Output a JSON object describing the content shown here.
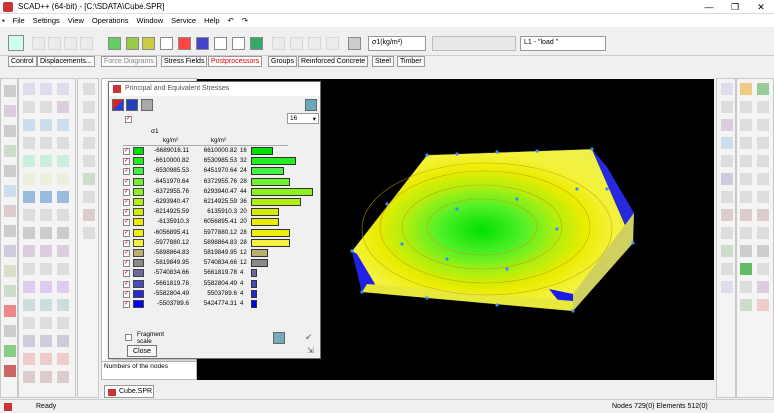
{
  "window": {
    "title": "SCAD++ (64-bit) - [C:\\SDATA\\Cube.SPR]",
    "controls": [
      "—",
      "❐",
      "✕"
    ]
  },
  "menu": [
    "File",
    "Settings",
    "View",
    "Operations",
    "Window",
    "Service",
    "Help"
  ],
  "toolbar": {
    "units_combo": "σ1(kg/m²)",
    "empty_combo": "",
    "load_combo": "L1 - \"load \""
  },
  "tabs": [
    "Control",
    "Displacements...",
    "Force Diagrams",
    "Stress Fields",
    "Postprocessors",
    "Groups",
    "Reinforced Concrete",
    "Steel",
    "Timber"
  ],
  "active_tab": "Postprocessors",
  "dialog": {
    "title": "Principal and Equivalent Stresses",
    "header_symbol": "σ1",
    "col1": "kg/m²",
    "col2": "kg/m²",
    "spin": "16",
    "fragment_label": "Fragment scale",
    "close": "Close",
    "rows": [
      {
        "from": "-6689016.11",
        "to": "6610000.82",
        "pct": "16",
        "color": "#00e000",
        "bar": 0.36
      },
      {
        "from": "-6610000.82",
        "to": "6530985.53",
        "pct": "32",
        "color": "#22ee22",
        "bar": 0.72
      },
      {
        "from": "-6530985.53",
        "to": "6451970.64",
        "pct": "24",
        "color": "#44f044",
        "bar": 0.54
      },
      {
        "from": "-6451970.64",
        "to": "6372955.76",
        "pct": "28",
        "color": "#6ff030",
        "bar": 0.63
      },
      {
        "from": "-6372955.76",
        "to": "6293940.47",
        "pct": "44",
        "color": "#8ef020",
        "bar": 1.0
      },
      {
        "from": "-6293940.47",
        "to": "6214925.59",
        "pct": "36",
        "color": "#b2ee10",
        "bar": 0.81
      },
      {
        "from": "-6214925.59",
        "to": "6135910.3",
        "pct": "20",
        "color": "#d2ec08",
        "bar": 0.45
      },
      {
        "from": "-6135910.3",
        "to": "6056895.41",
        "pct": "20",
        "color": "#eaec00",
        "bar": 0.45
      },
      {
        "from": "-6056895.41",
        "to": "5977880.12",
        "pct": "28",
        "color": "#f0ee10",
        "bar": 0.63
      },
      {
        "from": "-5977880.12",
        "to": "5898864.83",
        "pct": "28",
        "color": "#f6f040",
        "bar": 0.63
      },
      {
        "from": "-5898864.83",
        "to": "5819849.95",
        "pct": "12",
        "color": "#b8b070",
        "bar": 0.27
      },
      {
        "from": "-5819849.95",
        "to": "5740834.66",
        "pct": "12",
        "color": "#8a8a88",
        "bar": 0.27
      },
      {
        "from": "-5740834.66",
        "to": "5661819.78",
        "pct": "4",
        "color": "#6a6aa0",
        "bar": 0.09
      },
      {
        "from": "-5661819.78",
        "to": "5582804.49",
        "pct": "4",
        "color": "#4a4ac0",
        "bar": 0.09
      },
      {
        "from": "-5582804.49",
        "to": "5503789.6",
        "pct": "4",
        "color": "#2828d8",
        "bar": 0.09
      },
      {
        "from": "-5503789.6",
        "to": "5424774.31",
        "pct": "4",
        "color": "#0000ff",
        "bar": 0.09
      }
    ]
  },
  "bottom_tab": "Cube.SPR",
  "left_tree_label": "Numbers of the nodes",
  "status": {
    "left": "Ready",
    "right": "Nodes 729(0) Elements 512(0)"
  },
  "colors": {
    "accent_red": "#e00000",
    "viewport": "#000000"
  }
}
